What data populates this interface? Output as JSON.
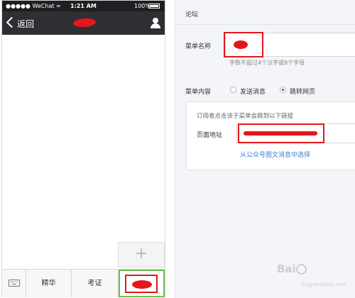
{
  "phone": {
    "status_bar": {
      "carrier": "●●●●● WeChat ≈",
      "time": "1:21 AM",
      "battery": "100%"
    },
    "nav": {
      "back_label": "返回"
    },
    "add_label": "+",
    "menu": {
      "items": [
        "精华",
        "考证"
      ]
    }
  },
  "editor": {
    "title": "论坛",
    "name_label": "菜单名称",
    "name_hint": "字数不超过4个汉字或8个字母",
    "content_label": "菜单内容",
    "options": [
      "发送消息",
      "跳转网页"
    ],
    "selected_option": "跳转网页",
    "link_desc": "订阅者点击该子菜单会跳到以下链接",
    "url_label": "页面地址",
    "choose_link": "从公众号图文消息中选择"
  },
  "watermark": {
    "text": "Bai",
    "sub": "jingyan.baidu.com"
  },
  "colors": {
    "redaction": "#e3171b",
    "active_menu_border": "#6cbf4c",
    "link": "#3c7fd0",
    "nav_bar": "#2f2f33"
  }
}
